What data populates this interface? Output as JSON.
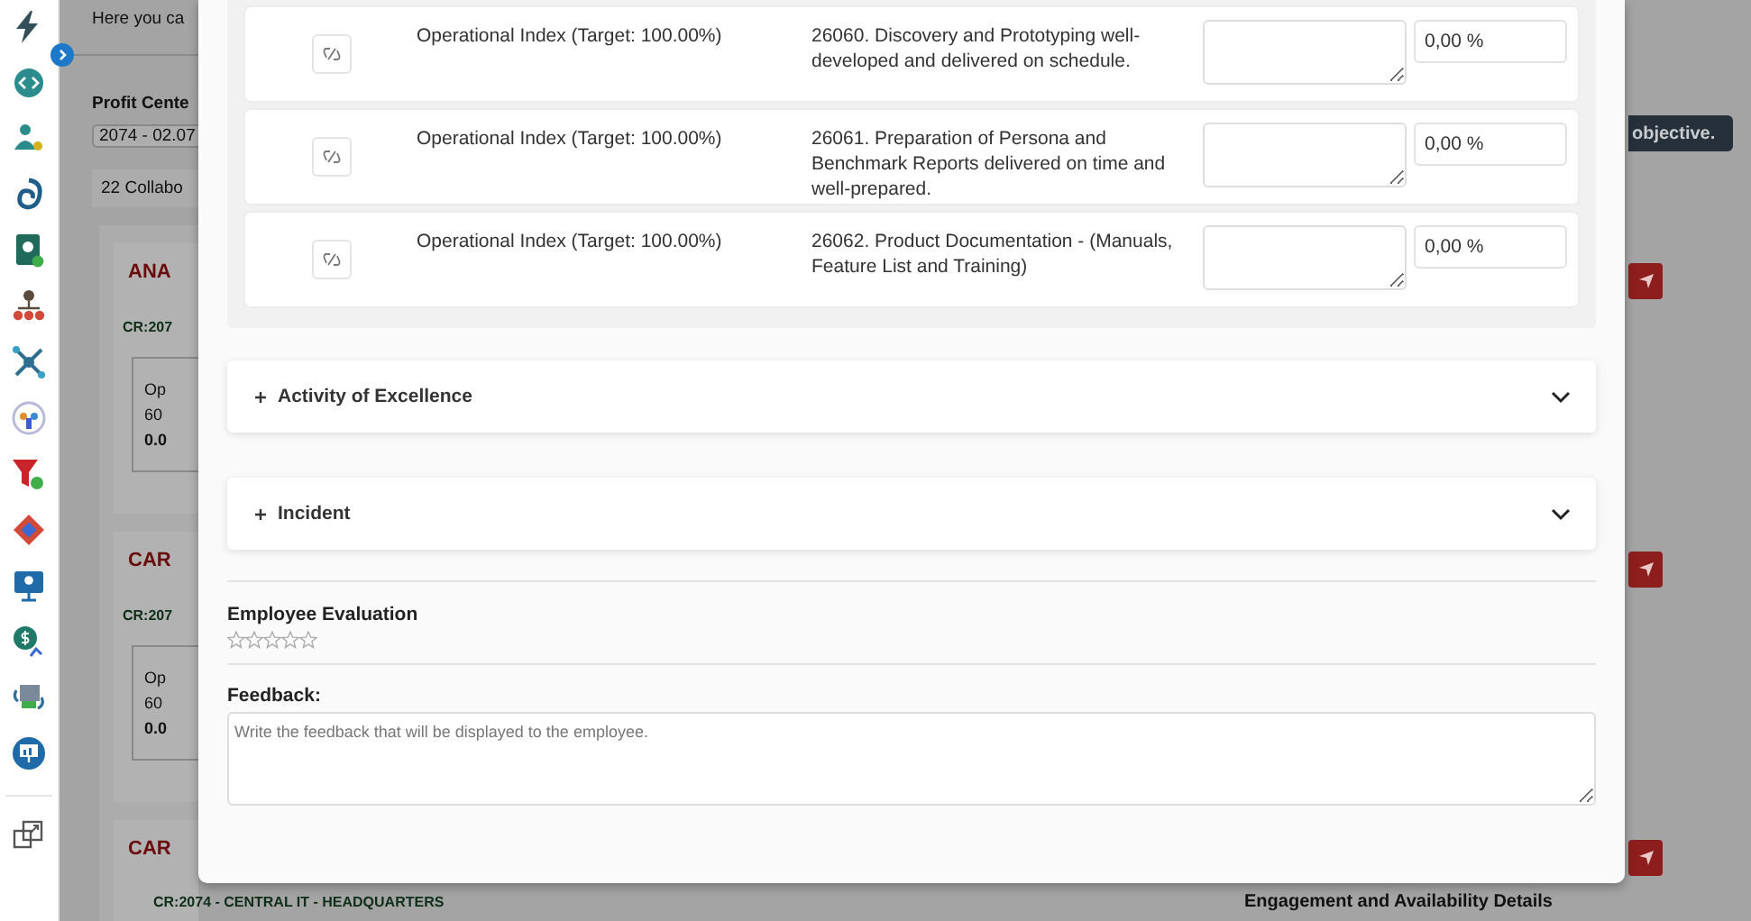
{
  "background": {
    "intro": "Here you ca",
    "profit_center_label": "Profit Cente",
    "profit_center_value": "2074 - 02.07",
    "collaborators": "22 Collabo",
    "objective_button": "objective.",
    "cards": [
      {
        "title": "ANA",
        "code": "CR:207",
        "lines": [
          "Op",
          "60",
          "0.0"
        ]
      },
      {
        "title": "CAR",
        "code": "CR:207",
        "lines": [
          "Op",
          "60",
          "0.0"
        ]
      },
      {
        "title": "CAR"
      }
    ],
    "footer_code": "CR:2074 - CENTRAL IT - HEADQUARTERS",
    "footer_panel": "Engagement and Availability Details"
  },
  "modal": {
    "objectives": [
      {
        "indicator": "Operational Index (Target: 100.00%)",
        "description": "26060. Discovery and Prototyping well-developed and delivered on schedule.",
        "score": "0,00 %"
      },
      {
        "indicator": "Operational Index (Target: 100.00%)",
        "description": "26061. Preparation of Persona and Benchmark Reports delivered on time and well-prepared.",
        "score": "0,00 %"
      },
      {
        "indicator": "Operational Index (Target: 100.00%)",
        "description": "26062. Product Documentation - (Manuals, Feature List and Training)",
        "score": "0,00 %"
      }
    ],
    "sections": [
      {
        "label": "Activity of Excellence",
        "expanded": false
      },
      {
        "label": "Incident",
        "expanded": false
      }
    ],
    "evaluation": {
      "label": "Employee Evaluation",
      "stars": 0
    },
    "feedback": {
      "label": "Feedback:",
      "placeholder": "Write the feedback that will be displayed to the employee."
    }
  }
}
